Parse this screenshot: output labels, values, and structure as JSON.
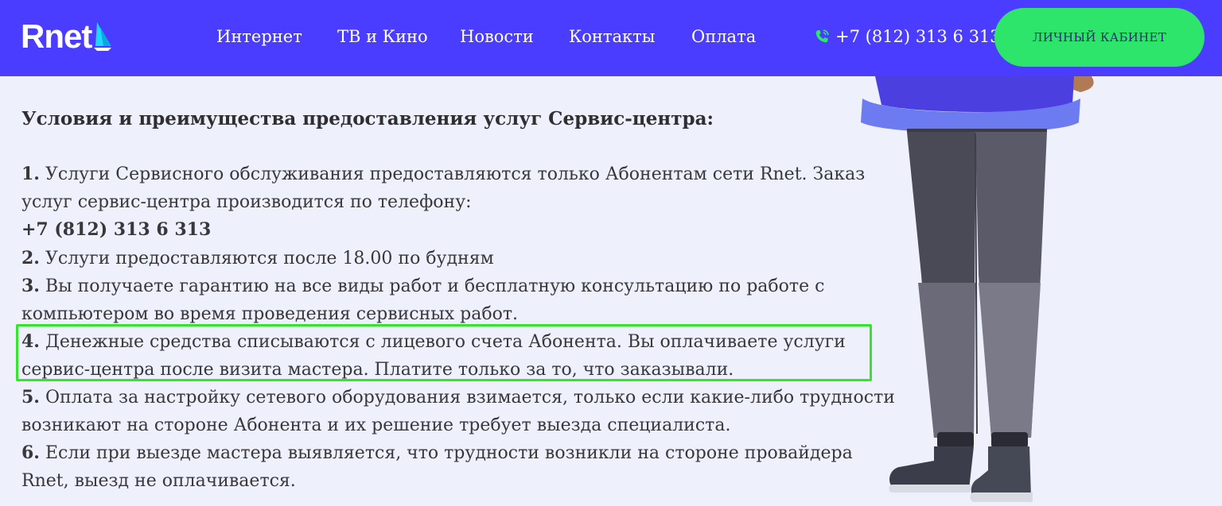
{
  "header": {
    "logo_text": "Rnet",
    "nav": [
      {
        "label": "Интернет"
      },
      {
        "label": "ТВ и Кино"
      },
      {
        "label": "Новости"
      },
      {
        "label": "Контакты"
      },
      {
        "label": "Оплата"
      }
    ],
    "phone": "+7 (812) 313 6 313",
    "cabinet_label": "ЛИЧНЫЙ КАБИНЕТ"
  },
  "content": {
    "heading": "Условия и преимущества предоставления услуг Сервис-центра:",
    "items": [
      {
        "num": "1.",
        "text": "Услуги Сервисного обслуживания предоставляются только Абонентам сети Rnet. Заказ услуг сервис-центра производится по телефону:",
        "phone": "+7 (812) 313 6 313"
      },
      {
        "num": "2.",
        "text": "Услуги предоставляются после 18.00 по будням"
      },
      {
        "num": "3.",
        "text": "Вы получаете гарантию на все виды работ и бесплатную консультацию по работе с компьютером во время проведения сервисных работ."
      },
      {
        "num": "4.",
        "text": "Денежные средства списываются с лицевого счета Абонента. Вы оплачиваете услуги сервис-центра после визита мастера. Платите только за то, что заказывали."
      },
      {
        "num": "5.",
        "text": "Оплата за настройку сетевого оборудования взимается, только если какие-либо трудности возникают на стороне Абонента и их решение требует выезда специалиста."
      },
      {
        "num": "6.",
        "text": "Если при выезде мастера выявляется, что трудности возникли на стороне провайдера Rnet, выезд не оплачивается."
      }
    ]
  },
  "colors": {
    "header_bg": "#4a3dff",
    "cabinet_bg": "#2de56b",
    "highlight_border": "#33e52b",
    "page_bg": "#eef0fb"
  },
  "icons": {
    "logo": "sail-icon",
    "phone": "phone-icon"
  }
}
